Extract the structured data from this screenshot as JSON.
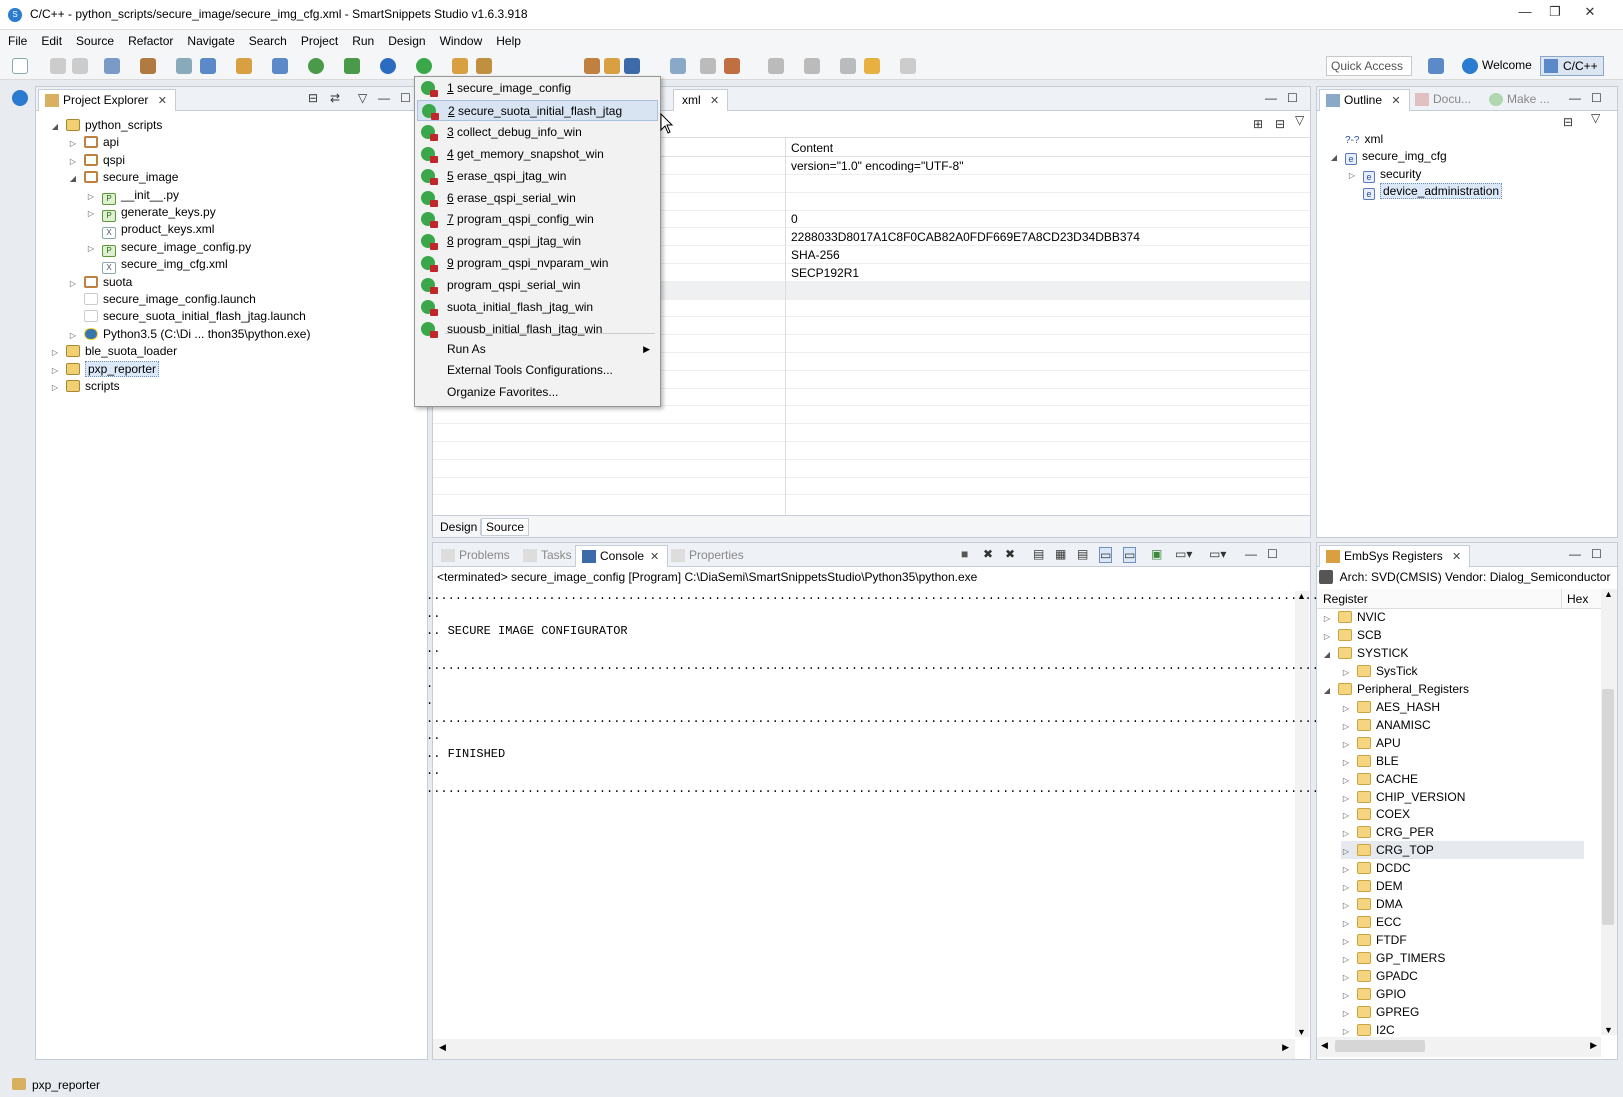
{
  "window": {
    "title": "C/C++ - python_scripts/secure_image/secure_img_cfg.xml - SmartSnippets Studio v1.6.3.918",
    "controls": [
      "—",
      "❐",
      "✕"
    ]
  },
  "menubar": [
    "File",
    "Edit",
    "Source",
    "Refactor",
    "Navigate",
    "Search",
    "Project",
    "Run",
    "Design",
    "Window",
    "Help"
  ],
  "toolbar": {
    "quick_access_placeholder": "Quick Access",
    "welcome_label": "Welcome",
    "perspective_label": "C/C++"
  },
  "project_explorer": {
    "tab_label": "Project Explorer",
    "tree": [
      {
        "label": "python_scripts",
        "depth": 0,
        "icon": "project-icon",
        "state": "expanded"
      },
      {
        "label": "api",
        "depth": 1,
        "icon": "package-icon",
        "state": "collapsed"
      },
      {
        "label": "qspi",
        "depth": 1,
        "icon": "package-icon",
        "state": "collapsed"
      },
      {
        "label": "secure_image",
        "depth": 1,
        "icon": "package-icon",
        "state": "expanded"
      },
      {
        "label": "__init__.py",
        "depth": 2,
        "icon": "python-file-icon",
        "state": "collapsed"
      },
      {
        "label": "generate_keys.py",
        "depth": 2,
        "icon": "python-file-icon",
        "state": "collapsed"
      },
      {
        "label": "product_keys.xml",
        "depth": 2,
        "icon": "xml-file-icon",
        "state": "leaf"
      },
      {
        "label": "secure_image_config.py",
        "depth": 2,
        "icon": "python-file-icon",
        "state": "collapsed"
      },
      {
        "label": "secure_img_cfg.xml",
        "depth": 2,
        "icon": "xml-file-icon",
        "state": "leaf"
      },
      {
        "label": "suota",
        "depth": 1,
        "icon": "package-icon",
        "state": "collapsed"
      },
      {
        "label": "secure_image_config.launch",
        "depth": 1,
        "icon": "launch-file-icon",
        "state": "leaf"
      },
      {
        "label": "secure_suota_initial_flash_jtag.launch",
        "depth": 1,
        "icon": "launch-file-icon",
        "state": "leaf"
      },
      {
        "label": "Python3.5  (C:\\Di ... thon35\\python.exe)",
        "depth": 1,
        "icon": "python-interpreter-icon",
        "state": "collapsed"
      },
      {
        "label": "ble_suota_loader",
        "depth": 0,
        "icon": "project-icon",
        "state": "collapsed"
      },
      {
        "label": "pxp_reporter",
        "depth": 0,
        "icon": "project-icon",
        "state": "collapsed",
        "selected": true
      },
      {
        "label": "scripts",
        "depth": 0,
        "icon": "project-icon",
        "state": "collapsed"
      }
    ]
  },
  "run_menu": {
    "items": [
      {
        "num": "1",
        "label": "secure_image_config"
      },
      {
        "num": "2",
        "label": "secure_suota_initial_flash_jtag",
        "highlighted": true
      },
      {
        "num": "3",
        "label": "collect_debug_info_win"
      },
      {
        "num": "4",
        "label": "get_memory_snapshot_win"
      },
      {
        "num": "5",
        "label": "erase_qspi_jtag_win"
      },
      {
        "num": "6",
        "label": "erase_qspi_serial_win"
      },
      {
        "num": "7",
        "label": "program_qspi_config_win"
      },
      {
        "num": "8",
        "label": "program_qspi_jtag_win"
      },
      {
        "num": "9",
        "label": "program_qspi_nvparam_win"
      },
      {
        "num": "",
        "label": "program_qspi_serial_win"
      },
      {
        "num": "",
        "label": "suota_initial_flash_jtag_win"
      },
      {
        "num": "",
        "label": "suousb_initial_flash_jtag_win"
      }
    ],
    "run_as": "Run As",
    "external_tools": "External Tools Configurations...",
    "organize": "Organize Favorites..."
  },
  "editor": {
    "tab_fragment": "xml",
    "content_header": "Content",
    "rows": [
      "version=\"1.0\" encoding=\"UTF-8\"",
      "",
      "",
      "0",
      "2288033D8017A1C8F0CAB82A0FDF669E7A8CD23D34DBB374",
      "SHA-256",
      "SECP192R1"
    ],
    "bottom_tabs": [
      "Design",
      "Source"
    ]
  },
  "outline": {
    "tabs": [
      "Outline",
      "Docu...",
      "Make ..."
    ],
    "tree": [
      {
        "label": "xml",
        "depth": 0,
        "icon": "xml-decl-icon"
      },
      {
        "label": "secure_img_cfg",
        "depth": 0,
        "icon": "element-icon",
        "state": "expanded"
      },
      {
        "label": "security",
        "depth": 1,
        "icon": "element-icon",
        "state": "collapsed"
      },
      {
        "label": "device_administration",
        "depth": 1,
        "icon": "element-icon",
        "selected": true
      }
    ]
  },
  "console": {
    "tabs": [
      "Problems",
      "Tasks",
      "Console",
      "Properties"
    ],
    "header": "<terminated> secure_image_config [Program] C:\\DiaSemi\\SmartSnippetsStudio\\Python35\\python.exe",
    "lines": [
      "....................................................................................................................................",
      "..",
      ".. SECURE IMAGE CONFIGURATOR",
      "..",
      "....................................................................................................................................",
      ".",
      ".",
      "....................................................................................................................................",
      "..",
      ".. FINISHED",
      "..",
      "...................................................................................................................................."
    ]
  },
  "registers": {
    "tab_label": "EmbSys Registers",
    "arch": "Arch: SVD(CMSIS)  Vendor: Dialog_Semiconductor",
    "col_register": "Register",
    "col_hex": "Hex",
    "tree": [
      {
        "label": "NVIC",
        "depth": 0,
        "state": "collapsed"
      },
      {
        "label": "SCB",
        "depth": 0,
        "state": "collapsed"
      },
      {
        "label": "SYSTICK",
        "depth": 0,
        "state": "expanded"
      },
      {
        "label": "SysTick",
        "depth": 1,
        "state": "collapsed"
      },
      {
        "label": "Peripheral_Registers",
        "depth": 0,
        "state": "expanded"
      },
      {
        "label": "AES_HASH",
        "depth": 1,
        "state": "collapsed"
      },
      {
        "label": "ANAMISC",
        "depth": 1,
        "state": "collapsed"
      },
      {
        "label": "APU",
        "depth": 1,
        "state": "collapsed"
      },
      {
        "label": "BLE",
        "depth": 1,
        "state": "collapsed"
      },
      {
        "label": "CACHE",
        "depth": 1,
        "state": "collapsed"
      },
      {
        "label": "CHIP_VERSION",
        "depth": 1,
        "state": "collapsed"
      },
      {
        "label": "COEX",
        "depth": 1,
        "state": "collapsed"
      },
      {
        "label": "CRG_PER",
        "depth": 1,
        "state": "collapsed"
      },
      {
        "label": "CRG_TOP",
        "depth": 1,
        "state": "collapsed",
        "selected": true
      },
      {
        "label": "DCDC",
        "depth": 1,
        "state": "collapsed"
      },
      {
        "label": "DEM",
        "depth": 1,
        "state": "collapsed"
      },
      {
        "label": "DMA",
        "depth": 1,
        "state": "collapsed"
      },
      {
        "label": "ECC",
        "depth": 1,
        "state": "collapsed"
      },
      {
        "label": "FTDF",
        "depth": 1,
        "state": "collapsed"
      },
      {
        "label": "GP_TIMERS",
        "depth": 1,
        "state": "collapsed"
      },
      {
        "label": "GPADC",
        "depth": 1,
        "state": "collapsed"
      },
      {
        "label": "GPIO",
        "depth": 1,
        "state": "collapsed"
      },
      {
        "label": "GPREG",
        "depth": 1,
        "state": "collapsed"
      },
      {
        "label": "I2C",
        "depth": 1,
        "state": "collapsed"
      }
    ]
  },
  "statusbar": {
    "text": "pxp_reporter"
  }
}
